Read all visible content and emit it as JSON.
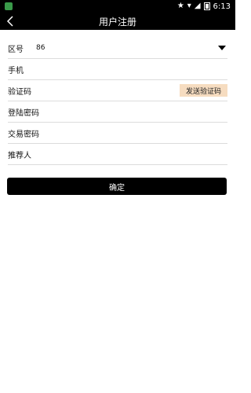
{
  "status_bar": {
    "time": "6:13",
    "icons": [
      "notification-app-icon",
      "star-icon",
      "wifi-icon",
      "signal-icon",
      "battery-icon"
    ]
  },
  "header": {
    "title": "用户注册",
    "back_icon": "chevron-left-icon"
  },
  "form": {
    "area_code": {
      "label": "区号",
      "value": "86"
    },
    "phone": {
      "label": "手机",
      "value": ""
    },
    "verification": {
      "label": "验证码",
      "value": "",
      "send_button": "发送验证码"
    },
    "login_password": {
      "label": "登陆密码",
      "value": ""
    },
    "trade_password": {
      "label": "交易密码",
      "value": ""
    },
    "referrer": {
      "label": "推荐人",
      "value": ""
    }
  },
  "actions": {
    "confirm": "确定"
  },
  "colors": {
    "bar_bg": "#000000",
    "send_button_bg": "#f6dcc0",
    "divider": "#dcdcdc"
  }
}
